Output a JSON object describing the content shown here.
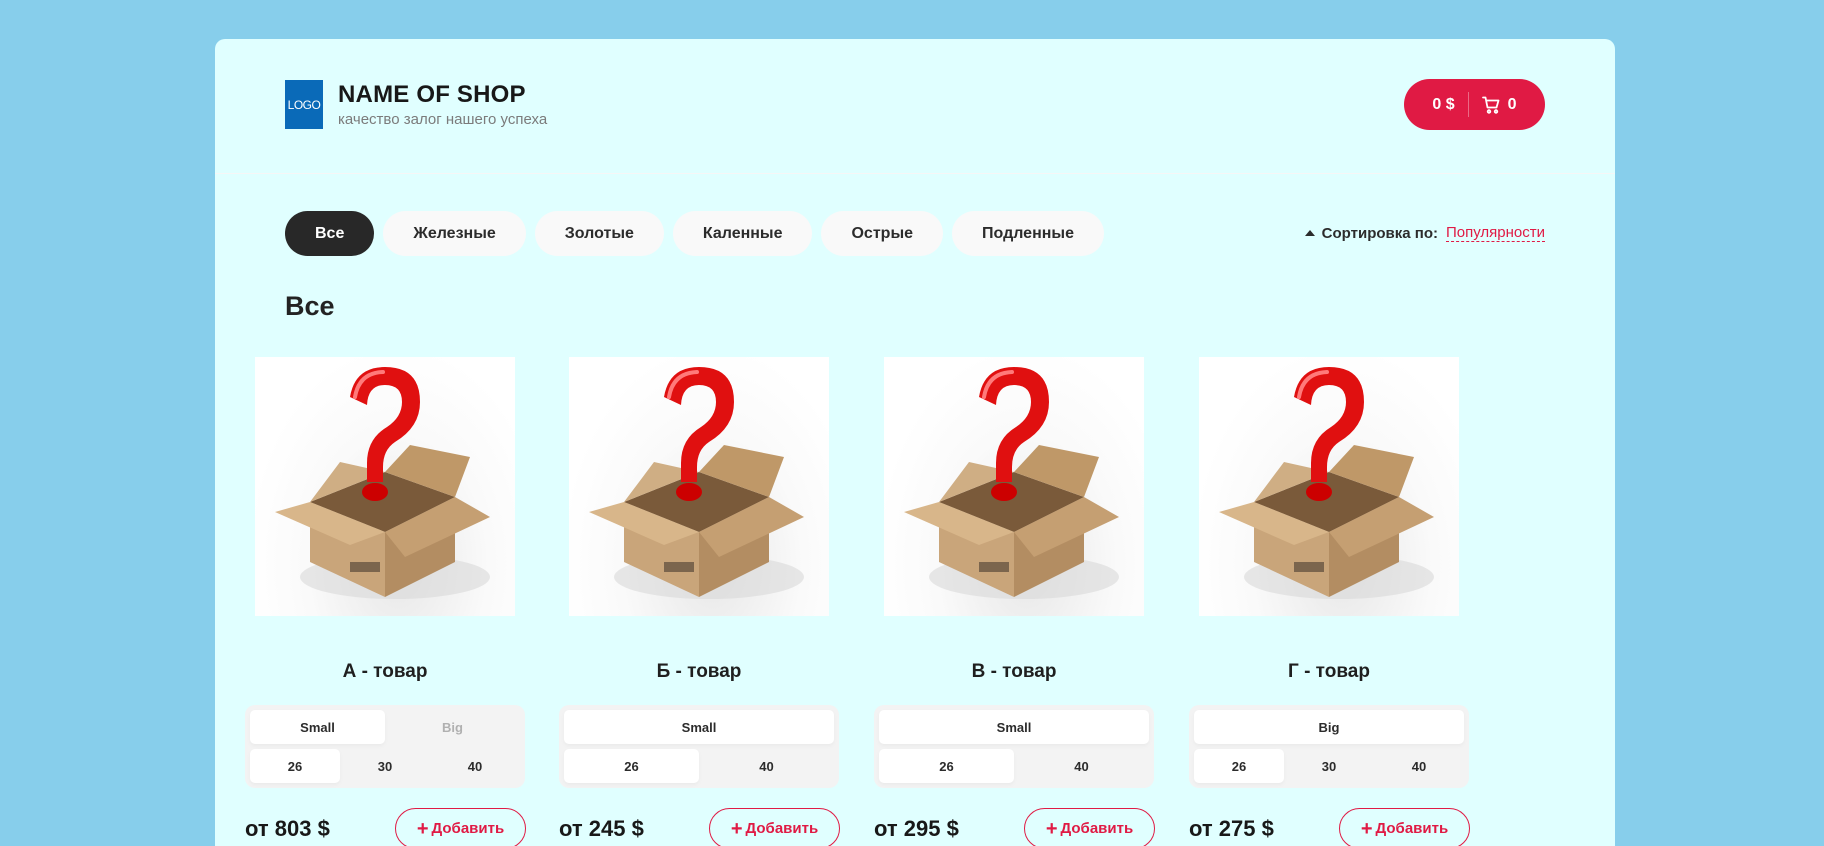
{
  "header": {
    "logo_text": "LOGO",
    "shop_name": "NAME OF SHOP",
    "tagline": "качество залог нашего успеха",
    "cart": {
      "total": "0 $",
      "count": "0"
    }
  },
  "categories": [
    "Все",
    "Железные",
    "Золотые",
    "Каленные",
    "Острые",
    "Подленные"
  ],
  "active_category": "Все",
  "sort": {
    "label": "Сортировка по:",
    "value": "Популярности"
  },
  "section_title": "Все",
  "add_label": "Добавить",
  "products": [
    {
      "name": "А - товар",
      "types": [
        {
          "label": "Small",
          "state": "active"
        },
        {
          "label": "Big",
          "state": "disabled"
        }
      ],
      "sizes": [
        {
          "label": "26",
          "state": "active"
        },
        {
          "label": "30",
          "state": ""
        },
        {
          "label": "40",
          "state": ""
        }
      ],
      "price": "от 803 $"
    },
    {
      "name": "Б - товар",
      "types": [
        {
          "label": "Small",
          "state": "active"
        }
      ],
      "sizes": [
        {
          "label": "26",
          "state": "active"
        },
        {
          "label": "40",
          "state": ""
        }
      ],
      "price": "от 245 $"
    },
    {
      "name": "В - товар",
      "types": [
        {
          "label": "Small",
          "state": "active"
        }
      ],
      "sizes": [
        {
          "label": "26",
          "state": "active"
        },
        {
          "label": "40",
          "state": ""
        }
      ],
      "price": "от 295 $"
    },
    {
      "name": "Г - товар",
      "types": [
        {
          "label": "Big",
          "state": "active"
        }
      ],
      "sizes": [
        {
          "label": "26",
          "state": "active"
        },
        {
          "label": "30",
          "state": ""
        },
        {
          "label": "40",
          "state": ""
        }
      ],
      "price": "от 275 $"
    }
  ],
  "colors": {
    "accent": "#e01a44",
    "page_bg": "#87ceeb",
    "content_bg": "#e0ffff",
    "active_tab": "#282828"
  },
  "icons": {
    "cart": "cart-icon",
    "sort": "caret-up-icon",
    "add": "plus-icon",
    "product_image": "mystery-box-image"
  }
}
